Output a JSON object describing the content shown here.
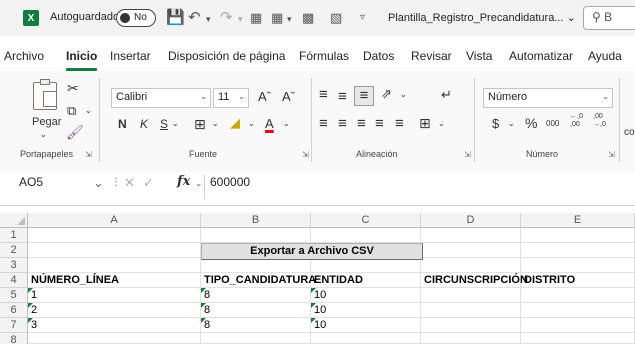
{
  "titlebar": {
    "app_icon": "X",
    "autosave_label": "Autoguardado",
    "autosave_state": "No",
    "file_name": "Plantilla_Registro_Precandidatura...",
    "search_placeholder": "B"
  },
  "menu": {
    "tabs": [
      "Archivo",
      "Inicio",
      "Insertar",
      "Disposición de página",
      "Fórmulas",
      "Datos",
      "Revisar",
      "Vista",
      "Automatizar",
      "Ayuda"
    ],
    "active_tab": "Inicio"
  },
  "ribbon": {
    "portapapeles": {
      "label": "Portapapeles",
      "paste_label": "Pegar"
    },
    "fuente": {
      "label": "Fuente",
      "font_name": "Calibri",
      "font_size": "11",
      "bold": "N",
      "italic": "K",
      "underline": "S",
      "grow": "Aˆ",
      "shrink": "Aˇ",
      "font_color_letter": "A"
    },
    "alineacion": {
      "label": "Alineación"
    },
    "numero": {
      "label": "Número",
      "format": "Número",
      "currency": "$",
      "percent": "%",
      "thousands": "000",
      "inc_decimals": "←,0 ,00",
      "dec_decimals": ",00 →,0"
    },
    "cut_off": "co"
  },
  "formula_bar": {
    "name_box": "AO5",
    "fx": "fx",
    "value": "600000"
  },
  "grid": {
    "columns": [
      "A",
      "B",
      "C",
      "D",
      "E"
    ],
    "rows": [
      "1",
      "2",
      "3",
      "4",
      "5",
      "6",
      "7",
      "8"
    ],
    "button_label": "Exportar a Archivo CSV",
    "headers": {
      "A": "NÚMERO_LÍNEA",
      "B": "TIPO_CANDIDATURA",
      "C": "ENTIDAD",
      "D": "CIRCUNSCRIPCIÓN",
      "E": "DISTRITO"
    },
    "data": [
      {
        "A": "1",
        "B": "8",
        "C": "10"
      },
      {
        "A": "2",
        "B": "8",
        "C": "10"
      },
      {
        "A": "3",
        "B": "8",
        "C": "10"
      }
    ]
  },
  "colors": {
    "accent": "#107c41",
    "header_bg": "#f3f3f3",
    "error_triangle": "#1e7b3c"
  }
}
